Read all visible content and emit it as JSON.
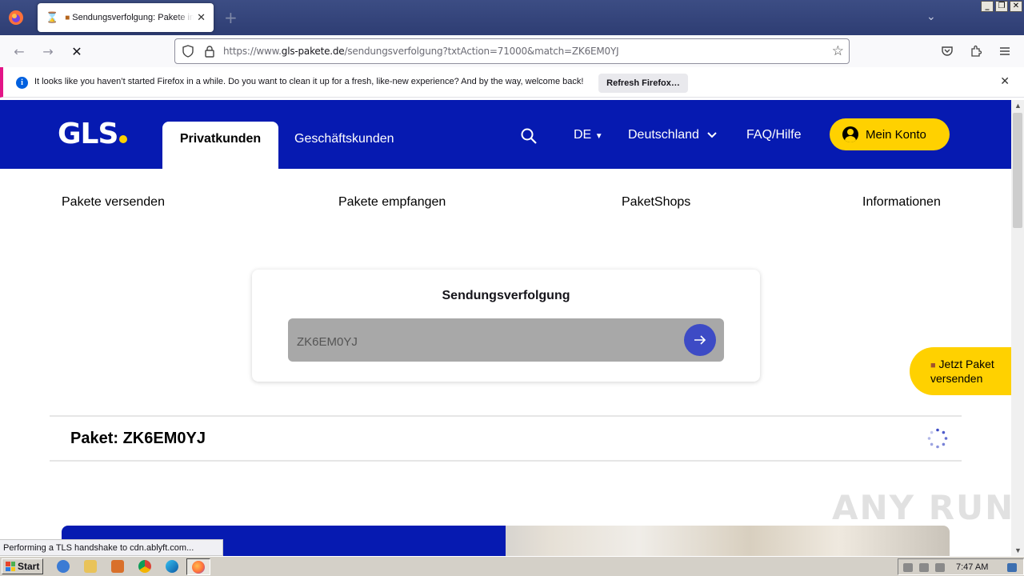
{
  "browser": {
    "tab_title": "Sendungsverfolgung: Pakete im",
    "tab_loading_icon": "hourglass-icon",
    "new_tab_label": "+",
    "url_prefix": "https://www.",
    "url_domain": "gls-pakete.de",
    "url_path": "/sendungsverfolgung?txtAction=71000&match=ZK6EM0YJ",
    "notification": "It looks like you haven’t started Firefox in a while. Do you want to clean it up for a fresh, like-new experience? And by the way, welcome back!",
    "refresh_button": "Refresh Firefox…",
    "status_text": "Performing a TLS handshake to cdn.ablyft.com..."
  },
  "site": {
    "logo": "GLS",
    "tabs": [
      "Privatkunden",
      "Geschäftskunden"
    ],
    "language": "DE",
    "country": "Deutschland",
    "faq": "FAQ/Hilfe",
    "account": "Mein Konto",
    "subnav": [
      "Pakete versenden",
      "Pakete empfangen",
      "PaketShops",
      "Informationen"
    ],
    "tracking": {
      "title": "Sendungsverfolgung",
      "input_value": "ZK6EM0YJ"
    },
    "floating_cta": [
      "Jetzt Paket",
      "versenden"
    ],
    "parcel_heading": "Paket: ZK6EM0YJ",
    "colors": {
      "brand_blue": "#061ab1",
      "brand_yellow": "#ffd100"
    }
  },
  "taskbar": {
    "start": "Start",
    "clock": "7:47 AM"
  },
  "watermark": "ANY RUN"
}
